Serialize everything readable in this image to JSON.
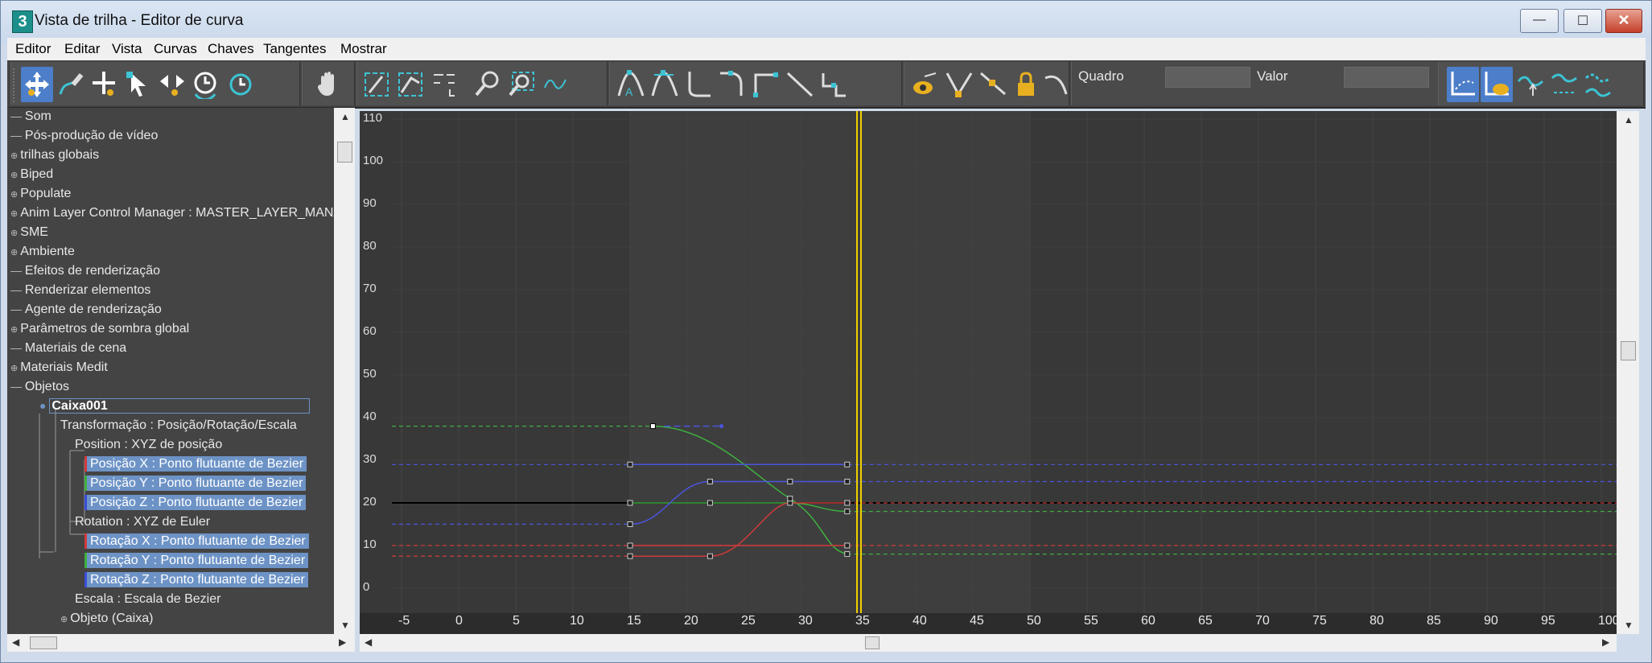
{
  "window": {
    "title": "Vista de trilha - Editor de curva",
    "app_icon_text": "3",
    "controls": {
      "minimize": "—",
      "maximize": "☐",
      "close": "✕"
    }
  },
  "menu": [
    "Editor",
    "Editar",
    "Vista",
    "Curvas",
    "Chaves",
    "Tangentes",
    "Mostrar"
  ],
  "toolbar": {
    "quadro_label": "Quadro",
    "quadro_value": "",
    "valor_label": "Valor",
    "valor_value": "",
    "icons": [
      "move-keys-icon",
      "draw-curves-icon",
      "add-keys-icon",
      "select-icon",
      "slide-keys-icon",
      "scale-keys-icon",
      "scale-values-icon",
      "pan-icon",
      "frame-horizontal-icon",
      "frame-values-icon",
      "isolate-icon",
      "zoom-icon",
      "zoom-region-icon",
      "snap-frames-icon",
      "tangent-auto-icon",
      "tangent-custom-icon",
      "tangent-fast-icon",
      "tangent-slow-icon",
      "tangent-step-icon",
      "tangent-linear-icon",
      "tangent-smooth-icon",
      "show-tangents-icon",
      "break-tangents-icon",
      "unify-tangents-icon",
      "lock-selection-icon",
      "parameter-curve-icon",
      "filter-icon",
      "show-selected-icon",
      "out-of-range-icon",
      "ease-in-icon",
      "ease-out-icon",
      "multiplier-icon"
    ]
  },
  "tree": [
    {
      "label": "Som",
      "indent": 0,
      "prefix": "—"
    },
    {
      "label": "Pós-produção de vídeo",
      "indent": 0,
      "prefix": "—"
    },
    {
      "label": "trilhas globais",
      "indent": 0,
      "prefix": "⊕"
    },
    {
      "label": "Biped",
      "indent": 0,
      "prefix": "⊕"
    },
    {
      "label": "Populate",
      "indent": 0,
      "prefix": "⊕"
    },
    {
      "label": "Anim Layer Control Manager : MASTER_LAYER_MANA",
      "indent": 0,
      "prefix": "⊕"
    },
    {
      "label": "SME",
      "indent": 0,
      "prefix": "⊕"
    },
    {
      "label": "Ambiente",
      "indent": 0,
      "prefix": "⊕"
    },
    {
      "label": "Efeitos de renderização",
      "indent": 0,
      "prefix": "—"
    },
    {
      "label": "Renderizar elementos",
      "indent": 0,
      "prefix": "—"
    },
    {
      "label": "Agente de renderização",
      "indent": 0,
      "prefix": "—"
    },
    {
      "label": "Parâmetros de sombra global",
      "indent": 0,
      "prefix": "⊕"
    },
    {
      "label": "Materiais de cena",
      "indent": 0,
      "prefix": "—"
    },
    {
      "label": "Materiais Medit",
      "indent": 0,
      "prefix": "⊕"
    },
    {
      "label": "Objetos",
      "indent": 0,
      "prefix": "—"
    },
    {
      "label": "Caixa001",
      "indent": 1,
      "prefix": "●",
      "bold": true
    },
    {
      "label": "Transformação : Posição/Rotação/Escala",
      "indent": 2,
      "prefix": ""
    },
    {
      "label": "Position : XYZ de posição",
      "indent": 3,
      "prefix": ""
    },
    {
      "label": "Posição X : Ponto flutuante de Bezier",
      "indent": 4,
      "prefix": "",
      "sel": true,
      "color": "#d23a3a"
    },
    {
      "label": "Posição Y : Ponto flutuante de Bezier",
      "indent": 4,
      "prefix": "",
      "sel": true,
      "color": "#3fb03f"
    },
    {
      "label": "Posição Z : Ponto flutuante de Bezier",
      "indent": 4,
      "prefix": "",
      "sel": true,
      "color": "#3a4ed8"
    },
    {
      "label": "Rotation : XYZ de Euler",
      "indent": 3,
      "prefix": ""
    },
    {
      "label": "Rotação X : Ponto flutuante de Bezier",
      "indent": 4,
      "prefix": "",
      "sel": true,
      "color": "#d23a3a"
    },
    {
      "label": "Rotação Y : Ponto flutuante de Bezier",
      "indent": 4,
      "prefix": "",
      "sel": true,
      "color": "#3fb03f"
    },
    {
      "label": "Rotação Z : Ponto flutuante de Bezier",
      "indent": 4,
      "prefix": "",
      "sel": true,
      "color": "#3a4ed8"
    },
    {
      "label": "Escala : Escala de Bezier",
      "indent": 3,
      "prefix": ""
    },
    {
      "label": "Objeto (Caixa)",
      "indent": 2,
      "prefix": "⊕"
    }
  ],
  "graph": {
    "y_labels": [
      "110",
      "100",
      "90",
      "80",
      "70",
      "60",
      "50",
      "40",
      "30",
      "20",
      "10",
      "0"
    ],
    "x_labels": [
      "-5",
      "0",
      "5",
      "10",
      "15",
      "20",
      "25",
      "30",
      "35",
      "40",
      "45",
      "50",
      "55",
      "60",
      "65",
      "70",
      "75",
      "80",
      "85",
      "90",
      "95",
      "100"
    ],
    "current_frame": 35,
    "colors": {
      "x": "#d23a3a",
      "y": "#3fb03f",
      "z": "#4a56e0",
      "time": "#f0d000"
    }
  }
}
